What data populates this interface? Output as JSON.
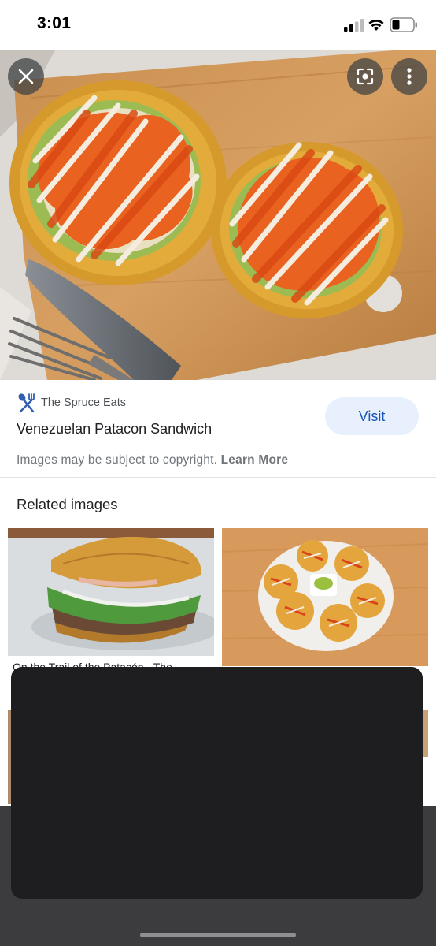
{
  "status_bar": {
    "time": "3:01"
  },
  "viewer": {
    "close_icon": "close-icon",
    "lens_icon": "google-lens-icon",
    "more_icon": "more-vert-icon"
  },
  "info": {
    "source_icon": "spoon-fork-icon",
    "source_name": "The Spruce Eats",
    "title": "Venezuelan Patacon Sandwich",
    "visit_label": "Visit",
    "copyright_text": "Images may be subject to copyright.",
    "learn_more_label": "Learn More"
  },
  "related": {
    "heading": "Related images",
    "items": [
      {
        "caption": "On the Trail of the Patacón - The"
      },
      {
        "caption": ""
      }
    ]
  },
  "colors": {
    "visit_bg": "#e8f0fe",
    "visit_text": "#1a56b9",
    "overlay_sheet": "#1e1e20"
  }
}
